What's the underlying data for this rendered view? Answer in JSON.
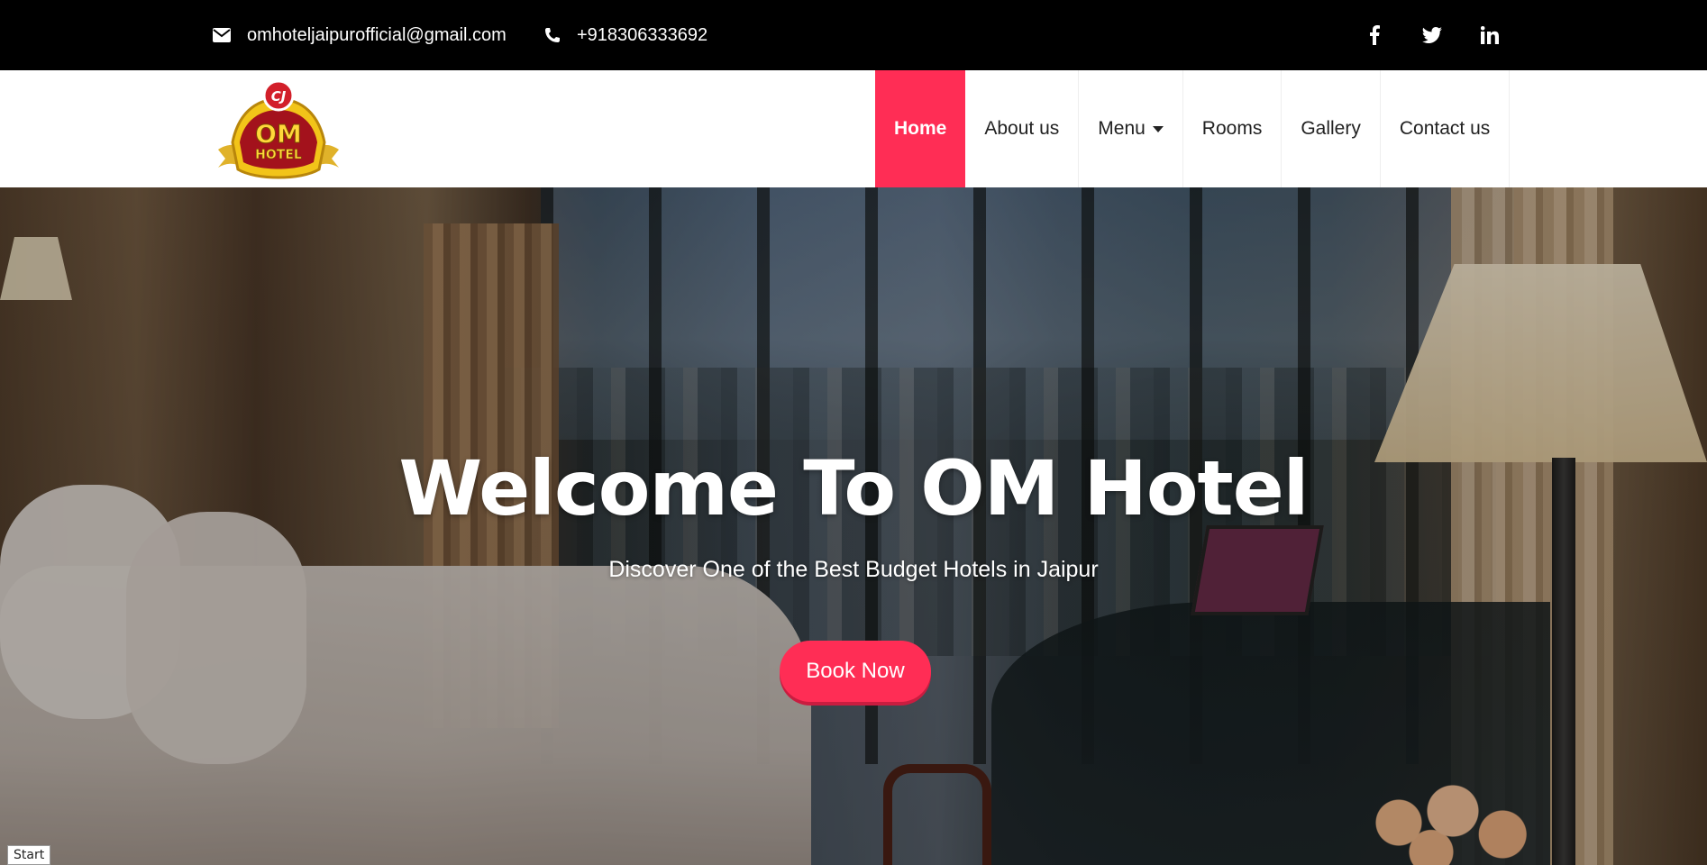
{
  "topbar": {
    "email": "omhoteljaipurofficial@gmail.com",
    "email_icon": "envelope-icon",
    "phone": "+918306333692",
    "phone_icon": "phone-icon",
    "socials": [
      {
        "name": "facebook-icon"
      },
      {
        "name": "twitter-icon"
      },
      {
        "name": "linkedin-icon"
      }
    ]
  },
  "brand": {
    "logo_alt": "OM HOTEL",
    "logo_line1": "OM",
    "logo_line2": "HOTEL",
    "logo_badge": "CJ"
  },
  "nav": {
    "items": [
      {
        "label": "Home",
        "active": true
      },
      {
        "label": "About us"
      },
      {
        "label": "Menu",
        "has_dropdown": true
      },
      {
        "label": "Rooms"
      },
      {
        "label": "Gallery"
      },
      {
        "label": "Contact us"
      }
    ]
  },
  "hero": {
    "title": "Welcome To OM Hotel",
    "subtitle": "Discover One of the Best Budget Hotels in Jaipur",
    "cta_label": "Book Now"
  },
  "status": {
    "label": "Start"
  },
  "colors": {
    "accent": "#ff2d55",
    "topbar_bg": "#000000",
    "nav_bg": "#ffffff"
  }
}
